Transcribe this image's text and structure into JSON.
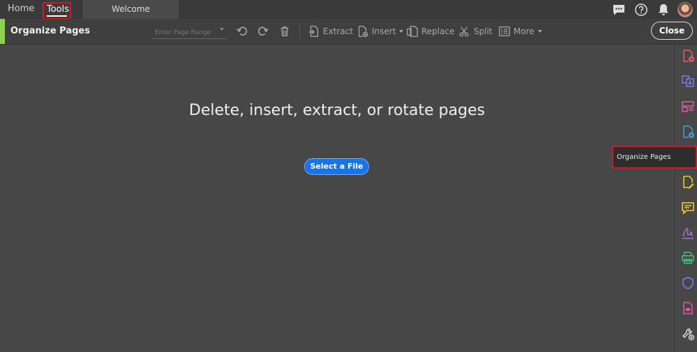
{
  "nav": {
    "home_label": "Home",
    "tools_label": "Tools",
    "tab_label": "Welcome"
  },
  "top_icons": [
    "chat-icon",
    "help-icon",
    "bell-icon",
    "avatar"
  ],
  "toolbar": {
    "title": "Organize Pages",
    "range_placeholder": "Enter Page Range",
    "extract_label": "Extract",
    "insert_label": "Insert",
    "replace_label": "Replace",
    "split_label": "Split",
    "more_label": "More",
    "close_label": "Close"
  },
  "main": {
    "headline": "Delete, insert, extract, or rotate pages",
    "select_label": "Select a File"
  },
  "rail": {
    "tooltip": "Organize Pages",
    "items": [
      "create-pdf-icon",
      "export-pdf-icon",
      "edit-pdf-icon",
      "combine-files-icon",
      "organize-pages-icon",
      "fill-sign-icon",
      "comment-icon",
      "sign-icon",
      "print-production-icon",
      "protect-icon",
      "form-icon",
      "more-tools-icon"
    ]
  },
  "colors": {
    "accent": "#8fd14f",
    "primary_button": "#1a73e8",
    "highlight_border": "#e0141e"
  }
}
